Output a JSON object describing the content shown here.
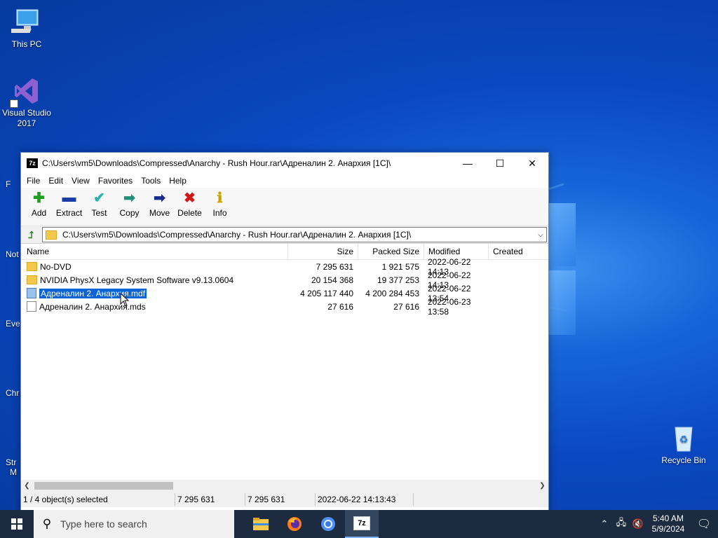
{
  "desktop": {
    "icons": [
      {
        "label": "This PC",
        "icon": "computer-icon"
      },
      {
        "label": "Visual Studio 2017",
        "icon": "visual-studio-icon"
      },
      {
        "label": "Recycle Bin",
        "icon": "recycle-bin-icon"
      }
    ],
    "partial_labels": [
      "F",
      "Not",
      "Eve",
      "Chr",
      "Str",
      "M"
    ]
  },
  "window": {
    "title": "C:\\Users\\vm5\\Downloads\\Compressed\\Anarchy - Rush Hour.rar\\Адреналин 2. Анархия [1C]\\",
    "controls": {
      "minimize": "—",
      "maximize": "☐",
      "close": "✕"
    },
    "menu": [
      "File",
      "Edit",
      "View",
      "Favorites",
      "Tools",
      "Help"
    ],
    "toolbar": [
      {
        "label": "Add",
        "icon": "add-icon",
        "glyph": "✚",
        "color": "#1f9b1f"
      },
      {
        "label": "Extract",
        "icon": "extract-icon",
        "glyph": "▬",
        "color": "#1a3ca8"
      },
      {
        "label": "Test",
        "icon": "test-icon",
        "glyph": "✔",
        "color": "#2bb3a8"
      },
      {
        "label": "Copy",
        "icon": "copy-icon",
        "glyph": "➡",
        "color": "#1f8f7a"
      },
      {
        "label": "Move",
        "icon": "move-icon",
        "glyph": "➡",
        "color": "#1a2a8c"
      },
      {
        "label": "Delete",
        "icon": "delete-icon",
        "glyph": "✖",
        "color": "#d01818"
      },
      {
        "label": "Info",
        "icon": "info-icon",
        "glyph": "ℹ",
        "color": "#c9a400"
      }
    ],
    "address": "C:\\Users\\vm5\\Downloads\\Compressed\\Anarchy - Rush Hour.rar\\Адреналин 2. Анархия [1C]\\",
    "columns": {
      "name": "Name",
      "size": "Size",
      "packed": "Packed Size",
      "modified": "Modified",
      "created": "Created"
    },
    "files": [
      {
        "name": "No-DVD",
        "type": "folder",
        "size": "7 295 631",
        "packed": "1 921 575",
        "modified": "2022-06-22 14:13",
        "selected": false
      },
      {
        "name": "NVIDIA PhysX Legacy System Software v9.13.0604",
        "type": "folder",
        "size": "20 154 368",
        "packed": "19 377 253",
        "modified": "2022-06-22 14:13",
        "selected": false
      },
      {
        "name": "Адреналин 2. Анархия.mdf",
        "type": "file",
        "size": "4 205 117 440",
        "packed": "4 200 284 453",
        "modified": "2022-06-22 13:54",
        "selected": true
      },
      {
        "name": "Адреналин 2. Анархия.mds",
        "type": "file",
        "size": "27 616",
        "packed": "27 616",
        "modified": "2022-06-23 13:58",
        "selected": false
      }
    ],
    "status": {
      "selected": "1 / 4 object(s) selected",
      "size": "7 295 631",
      "packed": "7 295 631",
      "modified": "2022-06-22 14:13:43"
    }
  },
  "taskbar": {
    "search_placeholder": "Type here to search",
    "apps": [
      {
        "name": "file-explorer",
        "icon": "folder-icon",
        "active": false
      },
      {
        "name": "firefox",
        "icon": "firefox-icon",
        "active": false
      },
      {
        "name": "chrome",
        "icon": "chrome-icon",
        "active": false
      },
      {
        "name": "7zip",
        "icon": "7zip-icon",
        "active": true
      }
    ],
    "time": "5:40 AM",
    "date": "5/9/2024"
  }
}
